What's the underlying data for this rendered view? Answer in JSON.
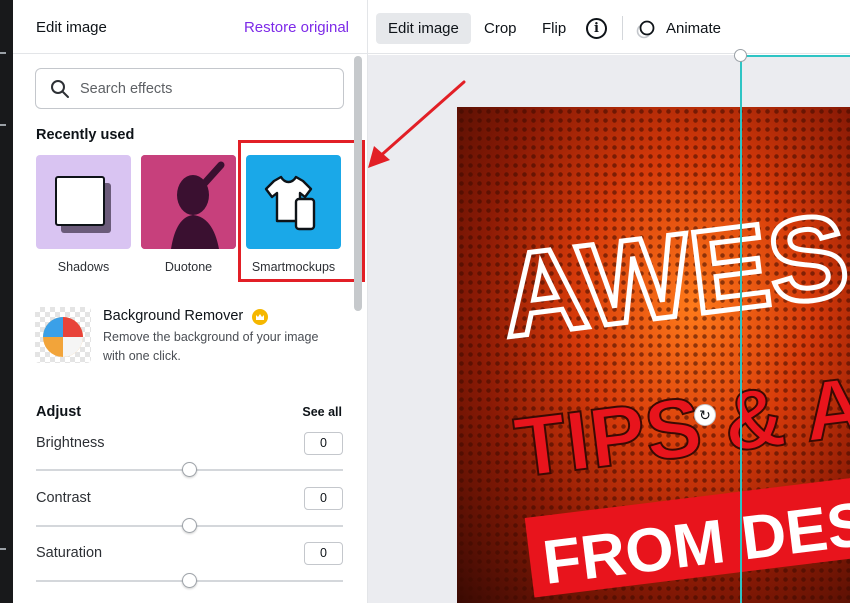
{
  "panel": {
    "title": "Edit image",
    "restore_label": "Restore original",
    "search_placeholder": "Search effects",
    "recently_used_heading": "Recently used",
    "effects": [
      {
        "label": "Shadows",
        "icon": "shadow-card-icon"
      },
      {
        "label": "Duotone",
        "icon": "duotone-portrait-thumbnail"
      },
      {
        "label": "Smartmockups",
        "icon": "tshirt-phone-icon",
        "highlighted": true
      }
    ],
    "background_remover": {
      "title": "Background Remover",
      "description": "Remove the background of your image with one click.",
      "badge_icon": "crown-icon"
    },
    "adjust": {
      "heading": "Adjust",
      "see_all": "See all",
      "items": [
        {
          "label": "Brightness",
          "value": "0",
          "slider_fraction": 0.5
        },
        {
          "label": "Contrast",
          "value": "0",
          "slider_fraction": 0.5
        },
        {
          "label": "Saturation",
          "value": "0",
          "slider_fraction": 0.5
        }
      ]
    }
  },
  "toolbar": {
    "edit_image": "Edit image",
    "crop": "Crop",
    "flip": "Flip",
    "info_icon": "info-icon",
    "animate": "Animate"
  },
  "canvas": {
    "design_texts": [
      "AWES",
      "TIPS & A",
      "FROM DESIG"
    ]
  },
  "colors": {
    "accent_purple": "#7d2ae8",
    "highlight_red": "#e21f26",
    "smartmockups_blue": "#1aa8e8",
    "selection_teal": "#2ec4c4"
  }
}
